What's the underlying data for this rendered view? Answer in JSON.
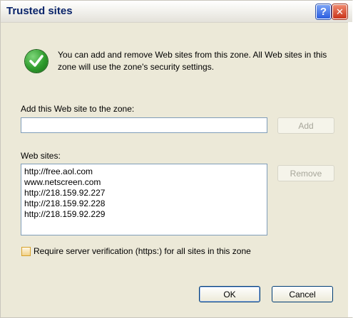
{
  "dialog": {
    "title": "Trusted sites",
    "help_label": "?",
    "close_label": "✕"
  },
  "info": {
    "icon": "green-checkmark-icon",
    "text": "You can add and remove Web sites from this zone. All Web sites in this zone will use the zone's security settings."
  },
  "add_section": {
    "label": "Add this Web site to the zone:",
    "input_value": "",
    "add_button": "Add"
  },
  "sites_section": {
    "label": "Web sites:",
    "sites": [
      "http://free.aol.com",
      "www.netscreen.com",
      "http://218.159.92.227",
      "http://218.159.92.228",
      "http://218.159.92.229"
    ],
    "remove_button": "Remove"
  },
  "verification": {
    "label": "Require server verification (https:) for all sites in this zone",
    "checked": false
  },
  "footer": {
    "ok_button": "OK",
    "cancel_button": "Cancel"
  }
}
